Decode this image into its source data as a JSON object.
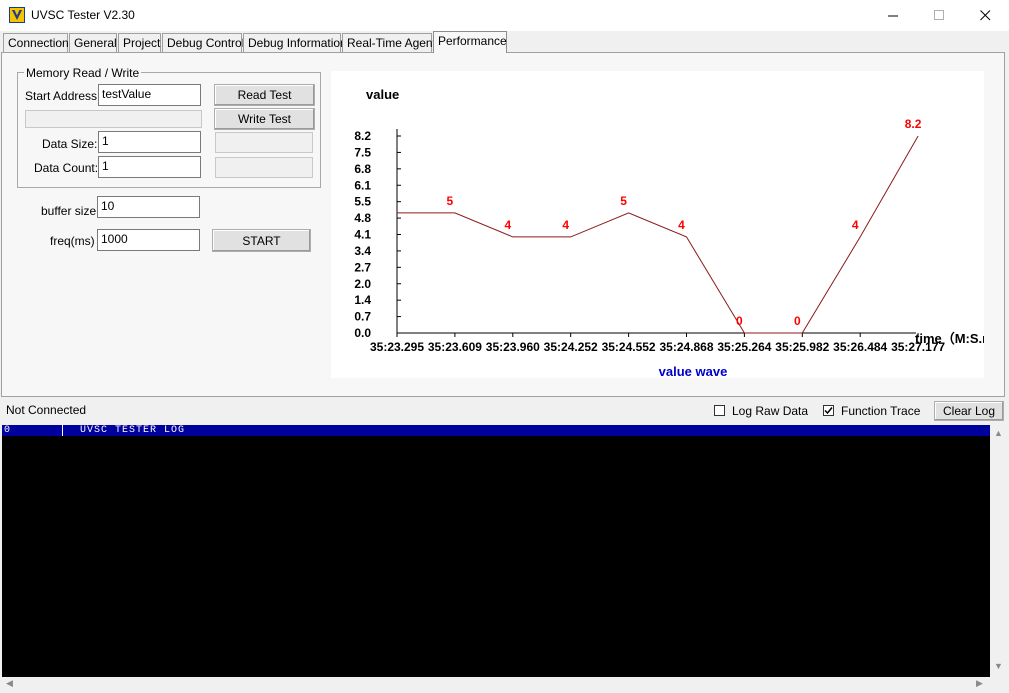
{
  "window": {
    "title": "UVSC Tester V2.30",
    "icon": "uvsc-app-icon"
  },
  "tabs": [
    {
      "label": "Connection",
      "active": false
    },
    {
      "label": "General",
      "active": false
    },
    {
      "label": "Project",
      "active": false
    },
    {
      "label": "Debug Control",
      "active": false
    },
    {
      "label": "Debug Information",
      "active": false
    },
    {
      "label": "Real-Time Agent",
      "active": false
    },
    {
      "label": "Performance",
      "active": true
    }
  ],
  "memory": {
    "group_label": "Memory Read / Write",
    "start_address_label": "Start Address:",
    "start_address_value": "testValue",
    "read_test_label": "Read Test",
    "write_test_label": "Write Test",
    "data_size_label": "Data Size:",
    "data_size_value": "1",
    "data_count_label": "Data Count:",
    "data_count_value": "1"
  },
  "perf": {
    "buffer_size_label": "buffer size",
    "buffer_size_value": "10",
    "freq_label": "freq(ms)",
    "freq_value": "1000",
    "start_label": "START"
  },
  "chart_data": {
    "type": "line",
    "ylabel": "value",
    "xlabel": "time（M:S.ms",
    "title": "value wave",
    "x": [
      "35:23.295",
      "35:23.609",
      "35:23.960",
      "35:24.252",
      "35:24.552",
      "35:24.868",
      "35:25.264",
      "35:25.982",
      "35:26.484",
      "35:27.177"
    ],
    "values": [
      5,
      5,
      4,
      4,
      5,
      4,
      0,
      0,
      4,
      8.2
    ],
    "point_labels": [
      "5",
      "4",
      "4",
      "5",
      "4",
      "0",
      "0",
      "4",
      "8.2"
    ],
    "yticks": [
      "0.0",
      "0.7",
      "1.4",
      "2.0",
      "2.7",
      "3.4",
      "4.1",
      "4.8",
      "5.5",
      "6.1",
      "6.8",
      "7.5",
      "8.2"
    ],
    "ylim": [
      0,
      8.2
    ],
    "line_color": "#8b1a1a",
    "label_color": "#ff0000",
    "title_color": "#0000cc"
  },
  "status": {
    "connection": "Not Connected",
    "log_raw_label": "Log Raw Data",
    "log_raw_checked": false,
    "function_trace_label": "Function Trace",
    "function_trace_checked": true,
    "clear_log_label": "Clear Log"
  },
  "log": {
    "header_index": "0",
    "header_text": "UVSC TESTER LOG"
  }
}
